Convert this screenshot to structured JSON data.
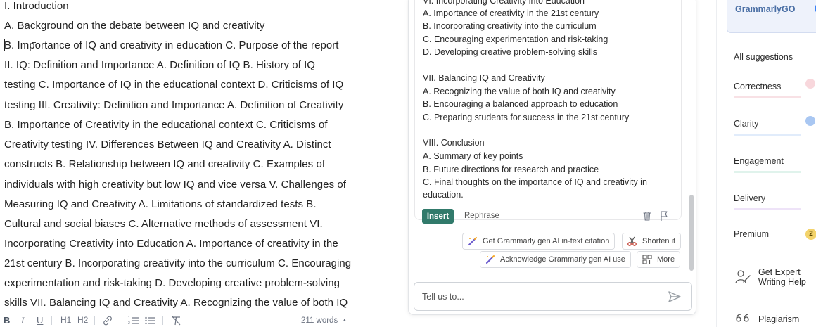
{
  "editor": {
    "lines": [
      "I. Introduction",
      " A. Background on the debate between IQ and creativity",
      "B. Importance of IQ and creativity in education C. Purpose of the report",
      "II. IQ: Definition and Importance A. Definition of IQ B. History of IQ",
      "testing C. Importance of IQ in the educational context D. Criticisms of IQ",
      "testing III. Creativity: Definition and Importance A. Definition of Creativity",
      "B. Importance of Creativity in the educational context C. Criticisms of",
      "Creativity testing IV. Differences Between IQ and Creativity A. Distinct",
      "constructs B. Relationship between IQ and creativity C. Examples of",
      "individuals with high creativity but low IQ and vice versa V. Challenges of",
      "Measuring IQ and Creativity A. Limitations of standardized tests B.",
      "Cultural and social biases C. Alternative methods of assessment VI.",
      "Incorporating Creativity into Education A. Importance of creativity in the",
      "21st century B. Incorporating creativity into the curriculum C. Encouraging",
      "experimentation and risk-taking D. Developing creative problem-solving",
      "skills VII. Balancing IQ and Creativity A. Recognizing the value of both IQ"
    ]
  },
  "toolbar": {
    "bold": "B",
    "italic": "I",
    "underline": "U",
    "h1": "H1",
    "h2": "H2",
    "word_count": "211 words"
  },
  "panel": {
    "output_lines": [
      "VI. Incorporating Creativity into Education",
      "A. Importance of creativity in the 21st century",
      "B. Incorporating creativity into the curriculum",
      "C. Encouraging experimentation and risk-taking",
      "D. Developing creative problem-solving skills",
      "",
      "VII. Balancing IQ and Creativity",
      "A. Recognizing the value of both IQ and creativity",
      "B. Encouraging a balanced approach to education",
      "C. Preparing students for success in the 21st century",
      "",
      "VIII. Conclusion",
      "A. Summary of key points",
      "B. Future directions for research and practice",
      "C. Final thoughts on the importance of IQ and creativity in",
      "education."
    ],
    "insert_label": "Insert",
    "rephrase_label": "Rephrase",
    "chips": {
      "citation": "Get Grammarly gen AI in-text citation",
      "shorten": "Shorten it",
      "acknowledge": "Acknowledge Grammarly gen AI use",
      "more": "More"
    },
    "input_placeholder": "Tell us to..."
  },
  "sidebar": {
    "go_label": "GrammarlyGO",
    "all_suggestions": "All suggestions",
    "items": [
      {
        "label": "Correctness",
        "color": "#f3b8c2"
      },
      {
        "label": "Clarity",
        "color": "#a9c7f2"
      },
      {
        "label": "Engagement",
        "color": "#a9dcc9"
      },
      {
        "label": "Delivery",
        "color": "#d9c3f0"
      }
    ],
    "premium_label": "Premium",
    "premium_count": "2",
    "expert_label_1": "Get Expert",
    "expert_label_2": "Writing Help",
    "plagiarism_label": "Plagiarism"
  }
}
